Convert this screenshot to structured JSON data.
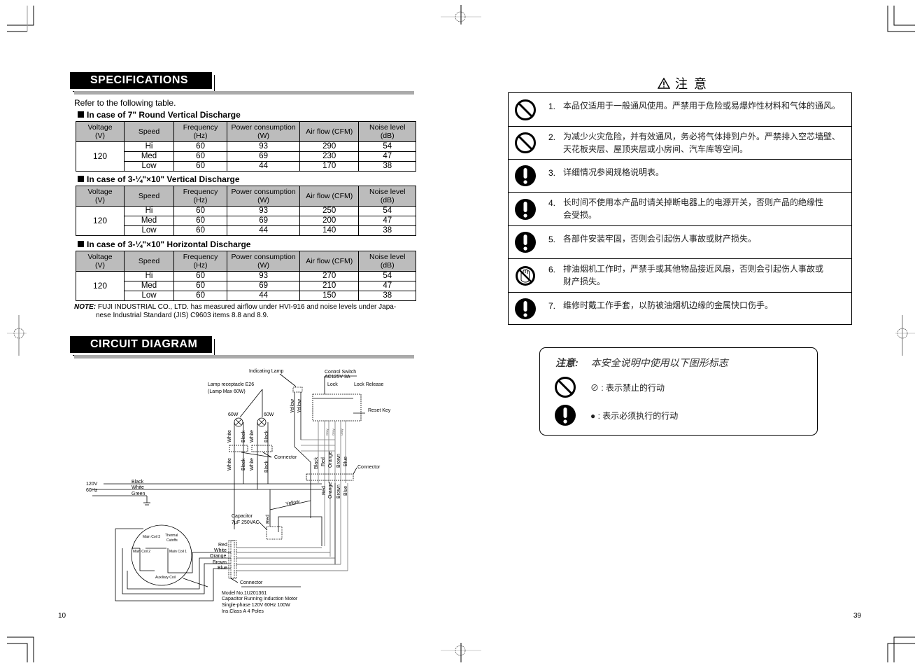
{
  "left_page": {
    "page_number": "10",
    "specifications": {
      "heading": "SPECIFICATIONS",
      "intro": "Refer to the following table.",
      "headers": [
        "Voltage\n(V)",
        "Speed",
        "Frequency\n(Hz)",
        "Power consumption\n(W)",
        "Air flow (CFM)",
        "Noise level\n(dB)"
      ],
      "header_lines": [
        [
          "Voltage",
          "(V)"
        ],
        [
          "Speed"
        ],
        [
          "Frequency",
          "(Hz)"
        ],
        [
          "Power consumption",
          "(W)"
        ],
        [
          "Air flow (CFM)"
        ],
        [
          "Noise level",
          "(dB)"
        ]
      ],
      "tables": [
        {
          "title": "In case of 7\" Round Vertical Discharge",
          "voltage": "120",
          "rows": [
            {
              "speed": "Hi",
              "frequency": "60",
              "power": "93",
              "airflow": "290",
              "noise": "54"
            },
            {
              "speed": "Med",
              "frequency": "60",
              "power": "69",
              "airflow": "230",
              "noise": "47"
            },
            {
              "speed": "Low",
              "frequency": "60",
              "power": "44",
              "airflow": "170",
              "noise": "38"
            }
          ]
        },
        {
          "title": "In case of 3-¼\"×10\" Vertical Discharge",
          "voltage": "120",
          "rows": [
            {
              "speed": "Hi",
              "frequency": "60",
              "power": "93",
              "airflow": "250",
              "noise": "54"
            },
            {
              "speed": "Med",
              "frequency": "60",
              "power": "69",
              "airflow": "200",
              "noise": "47"
            },
            {
              "speed": "Low",
              "frequency": "60",
              "power": "44",
              "airflow": "140",
              "noise": "38"
            }
          ]
        },
        {
          "title": "In case of 3-¼\"×10\" Horizontal Discharge",
          "voltage": "120",
          "rows": [
            {
              "speed": "Hi",
              "frequency": "60",
              "power": "93",
              "airflow": "270",
              "noise": "54"
            },
            {
              "speed": "Med",
              "frequency": "60",
              "power": "69",
              "airflow": "210",
              "noise": "47"
            },
            {
              "speed": "Low",
              "frequency": "60",
              "power": "44",
              "airflow": "150",
              "noise": "38"
            }
          ]
        }
      ],
      "note_label": "NOTE:",
      "note_line1": "FUJI INDUSTRIAL CO., LTD. has measured airflow under HVI-916 and noise levels under Japa-",
      "note_line2": "nese Industrial Standard (JIS) C9603 items 8.8 and 8.9."
    },
    "circuit_diagram": {
      "heading": "CIRCUIT DIAGRAM",
      "labels": {
        "indicating_lamp": "Indicating Lamp",
        "control_switch": "Control Switch",
        "control_switch_rating": "AC125V 3A",
        "lock": "Lock",
        "lock_release": "Lock Release",
        "reset_key": "Reset Key",
        "lamp_receptacle": "Lamp receptacle E26",
        "lamp_max": "(Lamp Max 60W)",
        "lamp_watt": "60W",
        "connector": "Connector",
        "supply_voltage": "120V",
        "supply_freq": "60Hz",
        "capacitor": "Capacitor",
        "capacitor_rating": "7µF 250VAC",
        "main_coil_1": "Main Coil 1",
        "main_coil_2": "Main Coil 2",
        "main_coil_3": "Main Coil 3",
        "thermal_cutoffs_1": "Thermal",
        "thermal_cutoffs_2": "Cutoffs",
        "auxiliary_coil": "Auxiliary Coil",
        "model_no": "Model No.1U201361",
        "motor_type": "Capacitor Running Induction Motor",
        "motor_rating": "Single-phase 120V 60Hz 100W",
        "motor_class": "Ins.Class A 4 Poles"
      },
      "wires": {
        "black": "Black",
        "white": "White",
        "green": "Green",
        "yellow": "Yellow",
        "red": "Red",
        "orange": "Orange",
        "brown": "Brown",
        "blue": "Blue",
        "gray": "Gray"
      }
    }
  },
  "right_page": {
    "page_number": "39",
    "caution_title": "注 意",
    "warnings": [
      {
        "num": "1.",
        "icon": "prohibition-icon",
        "lines": [
          "本品仅适用于一般通风使用。严禁用于危险或易爆炸性材料和气体的通风。"
        ]
      },
      {
        "num": "2.",
        "icon": "prohibition-icon",
        "lines": [
          "为减少火灾危险，并有效通风，务必将气体排到户外。严禁排入空芯墙壁、",
          "天花板夹层、屋顶夹层或小房间、汽车库等空间。"
        ]
      },
      {
        "num": "3.",
        "icon": "mandatory-icon",
        "lines": [
          "详细情况参阅规格说明表。"
        ]
      },
      {
        "num": "4.",
        "icon": "mandatory-icon",
        "lines": [
          "长时间不使用本产品时请关掉断电器上的电源开关，否则产品的绝缘性",
          "会受损。"
        ]
      },
      {
        "num": "5.",
        "icon": "mandatory-icon",
        "lines": [
          "各部件安装牢固，否则会引起伤人事故或财产损失。"
        ]
      },
      {
        "num": "6.",
        "icon": "no-hands-icon",
        "lines": [
          "排油烟机工作时，严禁手或其他物品接近风扇，否则会引起伤人事故或",
          "财产损失。"
        ]
      },
      {
        "num": "7.",
        "icon": "mandatory-icon",
        "lines": [
          "维修时戴工作手套，以防被油烟机边缘的金属快口伤手。"
        ]
      }
    ],
    "legend": {
      "title_key": "注意:",
      "title_text": "本安全说明中使用以下图形标志",
      "items": [
        {
          "icon": "prohibition-icon",
          "text": "⊘ : 表示禁止的行动"
        },
        {
          "icon": "mandatory-icon",
          "text": "● : 表示必须执行的行动"
        }
      ]
    }
  }
}
